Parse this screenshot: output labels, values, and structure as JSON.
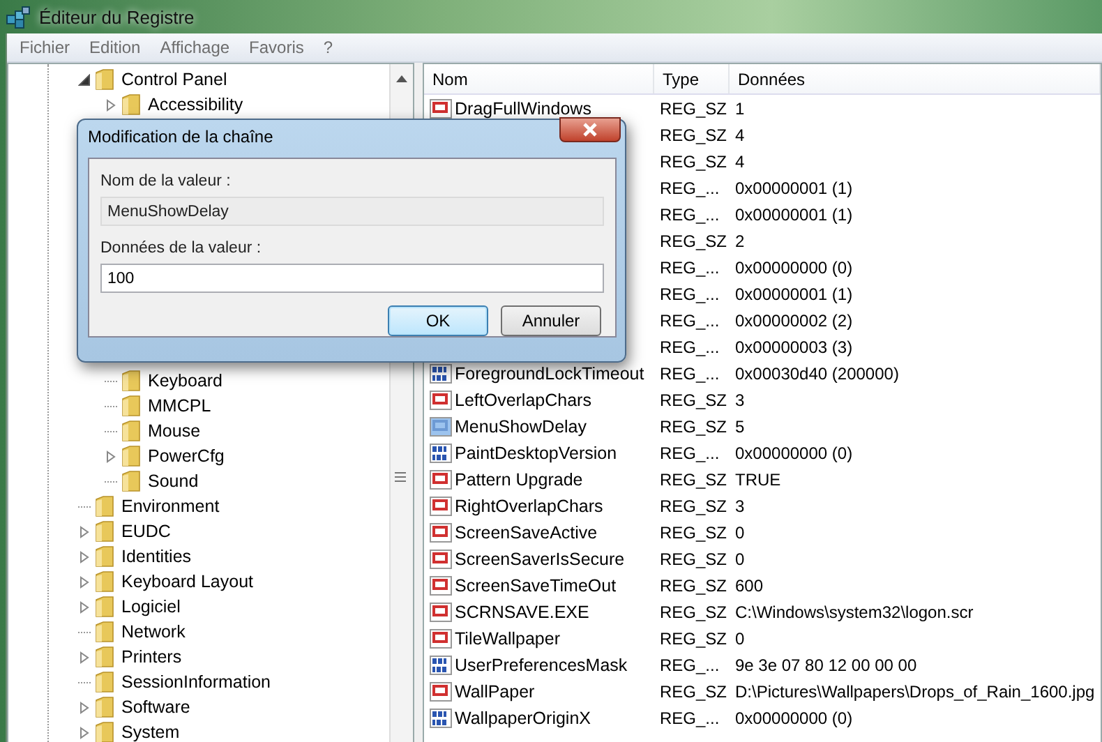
{
  "window": {
    "title": "Éditeur du Registre"
  },
  "menu": [
    "Fichier",
    "Edition",
    "Affichage",
    "Favoris",
    "?"
  ],
  "tree": [
    {
      "label": "Control Panel",
      "expanded": true,
      "children": [
        {
          "label": "Accessibility",
          "expandable": true
        },
        {
          "label": "Keyboard",
          "expandable": false
        },
        {
          "label": "MMCPL",
          "expandable": false
        },
        {
          "label": "Mouse",
          "expandable": false
        },
        {
          "label": "PowerCfg",
          "expandable": true
        },
        {
          "label": "Sound",
          "expandable": false
        }
      ]
    },
    {
      "label": "Environment",
      "expandable": false
    },
    {
      "label": "EUDC",
      "expandable": true
    },
    {
      "label": "Identities",
      "expandable": true
    },
    {
      "label": "Keyboard Layout",
      "expandable": true
    },
    {
      "label": "Logiciel",
      "expandable": true
    },
    {
      "label": "Network",
      "expandable": false
    },
    {
      "label": "Printers",
      "expandable": true
    },
    {
      "label": "SessionInformation",
      "expandable": false
    },
    {
      "label": "Software",
      "expandable": true
    },
    {
      "label": "System",
      "expandable": true
    }
  ],
  "table": {
    "columns": [
      "Nom",
      "Type",
      "Données"
    ],
    "rows": [
      {
        "name": "DragFullWindows",
        "kind": "string",
        "type": "REG_SZ",
        "data": "1",
        "selected": false
      },
      {
        "type": "REG_SZ",
        "data": "4"
      },
      {
        "type": "REG_SZ",
        "data": "4"
      },
      {
        "type": "REG_...",
        "data": "0x00000001 (1)"
      },
      {
        "type": "REG_...",
        "data": "0x00000001 (1)"
      },
      {
        "type": "REG_SZ",
        "data": "2"
      },
      {
        "type": "REG_...",
        "data": "0x00000000 (0)"
      },
      {
        "type": "REG_...",
        "data": "0x00000001 (1)"
      },
      {
        "type": "REG_...",
        "data": "0x00000002 (2)"
      },
      {
        "type": "REG_...",
        "data": "0x00000003 (3)"
      },
      {
        "name": "ForegroundLockTimeout",
        "kind": "binary",
        "type": "REG_...",
        "data": "0x00030d40 (200000)",
        "selected": false
      },
      {
        "name": "LeftOverlapChars",
        "kind": "string",
        "type": "REG_SZ",
        "data": "3",
        "selected": false
      },
      {
        "name": "MenuShowDelay",
        "kind": "string",
        "type": "REG_SZ",
        "data": "5",
        "selected": true
      },
      {
        "name": "PaintDesktopVersion",
        "kind": "binary",
        "type": "REG_...",
        "data": "0x00000000 (0)",
        "selected": false
      },
      {
        "name": "Pattern Upgrade",
        "kind": "string",
        "type": "REG_SZ",
        "data": "TRUE",
        "selected": false
      },
      {
        "name": "RightOverlapChars",
        "kind": "string",
        "type": "REG_SZ",
        "data": "3",
        "selected": false
      },
      {
        "name": "ScreenSaveActive",
        "kind": "string",
        "type": "REG_SZ",
        "data": "0",
        "selected": false
      },
      {
        "name": "ScreenSaverIsSecure",
        "kind": "string",
        "type": "REG_SZ",
        "data": "0",
        "selected": false
      },
      {
        "name": "ScreenSaveTimeOut",
        "kind": "string",
        "type": "REG_SZ",
        "data": "600",
        "selected": false
      },
      {
        "name": "SCRNSAVE.EXE",
        "kind": "string",
        "type": "REG_SZ",
        "data": "C:\\Windows\\system32\\logon.scr",
        "selected": false
      },
      {
        "name": "TileWallpaper",
        "kind": "string",
        "type": "REG_SZ",
        "data": "0",
        "selected": false
      },
      {
        "name": "UserPreferencesMask",
        "kind": "binary",
        "type": "REG_...",
        "data": "9e 3e 07 80 12 00 00 00",
        "selected": false
      },
      {
        "name": "WallPaper",
        "kind": "string",
        "type": "REG_SZ",
        "data": "D:\\Pictures\\Wallpapers\\Drops_of_Rain_1600.jpg",
        "selected": false
      },
      {
        "name": "WallpaperOriginX",
        "kind": "binary",
        "type": "REG_...",
        "data": "0x00000000 (0)",
        "selected": false
      }
    ]
  },
  "dialog": {
    "title": "Modification de la chaîne",
    "name_label": "Nom de la valeur :",
    "name_value": "MenuShowDelay",
    "data_label": "Données de la valeur :",
    "data_value": "100",
    "buttons": [
      {
        "label": "OK",
        "default": true
      },
      {
        "label": "Annuler",
        "default": false
      }
    ]
  }
}
